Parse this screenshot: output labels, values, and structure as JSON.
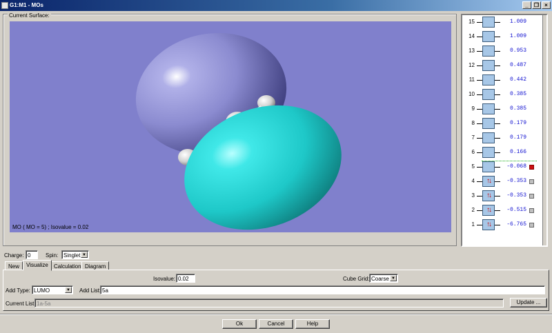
{
  "window": {
    "title": "G1:M1 - MOs"
  },
  "viewer": {
    "group_label": "Current Surface:",
    "caption": "MO ( MO = 5) ; Isovalue = 0.02"
  },
  "orbitals": [
    {
      "num": "15",
      "energy": "1.009",
      "occ": "",
      "mark": "none"
    },
    {
      "num": "14",
      "energy": "1.009",
      "occ": "",
      "mark": "none"
    },
    {
      "num": "13",
      "energy": "0.953",
      "occ": "",
      "mark": "none"
    },
    {
      "num": "12",
      "energy": "0.487",
      "occ": "",
      "mark": "none"
    },
    {
      "num": "11",
      "energy": "0.442",
      "occ": "",
      "mark": "none"
    },
    {
      "num": "10",
      "energy": "0.385",
      "occ": "",
      "mark": "none"
    },
    {
      "num": "9",
      "energy": "0.385",
      "occ": "",
      "mark": "none"
    },
    {
      "num": "8",
      "energy": "0.179",
      "occ": "",
      "mark": "none"
    },
    {
      "num": "7",
      "energy": "0.179",
      "occ": "",
      "mark": "none"
    },
    {
      "num": "6",
      "energy": "0.166",
      "occ": "",
      "mark": "none"
    },
    {
      "num": "5",
      "energy": "-0.068",
      "occ": "",
      "mark": "red"
    },
    {
      "num": "4",
      "energy": "-0.353",
      "occ": "↑↓",
      "mark": "gray"
    },
    {
      "num": "3",
      "energy": "-0.353",
      "occ": "↑↓",
      "mark": "gray"
    },
    {
      "num": "2",
      "energy": "-0.515",
      "occ": "↑↓",
      "mark": "gray"
    },
    {
      "num": "1",
      "energy": "-6.765",
      "occ": "↑↓",
      "mark": "gray"
    }
  ],
  "charge": {
    "label": "Charge:",
    "value": "0"
  },
  "spin": {
    "label": "Spin:",
    "value": "Singlet"
  },
  "tabs": [
    {
      "label": "New",
      "active": false
    },
    {
      "label": "Visualize",
      "active": true
    },
    {
      "label": "Calculation",
      "active": false
    },
    {
      "label": "Diagram",
      "active": false
    }
  ],
  "visualize": {
    "isovalue_label": "Isovalue:",
    "isovalue": "0.02",
    "cube_grid_label": "Cube Grid:",
    "cube_grid": "Coarse",
    "add_type_label": "Add Type:",
    "add_type": "LUMO",
    "add_list_label": "Add List:",
    "add_list": "5a",
    "current_list_label": "Current List:",
    "current_list": "1a-5a",
    "update_label": "Update ..."
  },
  "footer": {
    "ok": "Ok",
    "cancel": "Cancel",
    "help": "Help"
  },
  "colors": {
    "viewport_bg": "#8080cc",
    "lobe_negative": "#8b8bd0",
    "lobe_positive": "#1ec8c8",
    "energy_text": "#1010d0",
    "lumo_marker": "#cc1111"
  }
}
